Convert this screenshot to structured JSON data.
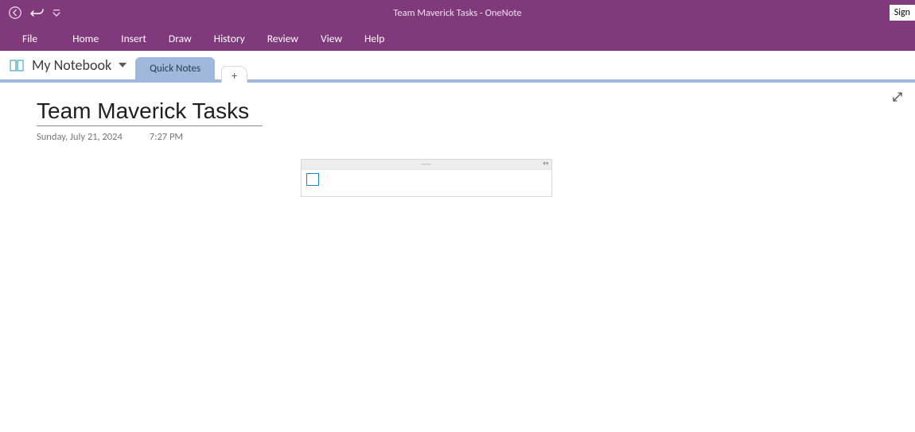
{
  "app_title": "Team Maverick Tasks  -  OneNote",
  "signin_label": "Sign",
  "menus": {
    "file": "File",
    "home": "Home",
    "insert": "Insert",
    "draw": "Draw",
    "history": "History",
    "review": "Review",
    "view": "View",
    "help": "Help"
  },
  "notebook": {
    "name": "My Notebook"
  },
  "section_tabs": {
    "active": "Quick Notes",
    "add_label": "+"
  },
  "page": {
    "title": "Team Maverick Tasks",
    "date": "Sunday, July 21, 2024",
    "time": "7:27 PM"
  },
  "note_outline": {
    "grip_dots": "····",
    "resize_glyph": "↔"
  }
}
